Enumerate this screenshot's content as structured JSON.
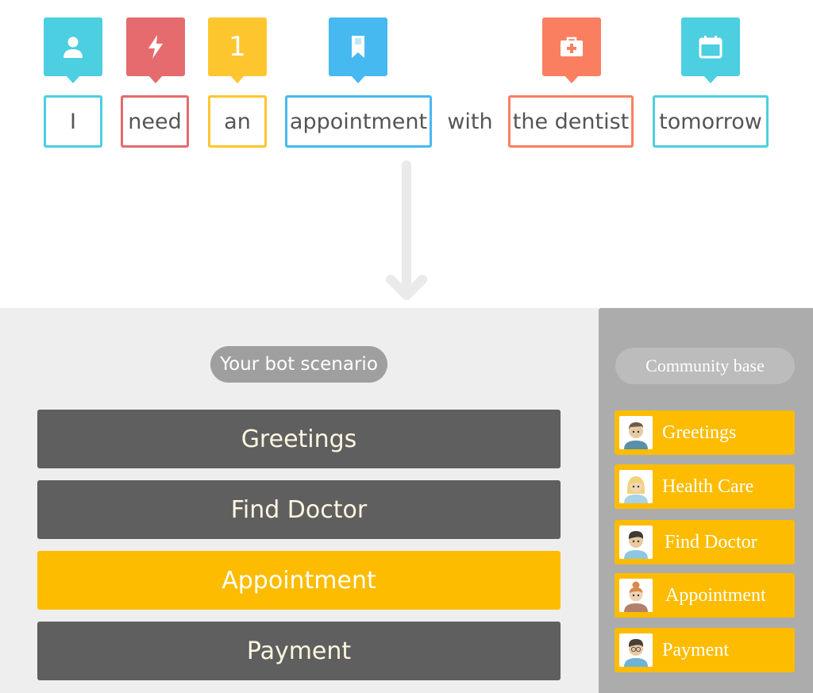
{
  "tokens": [
    {
      "word": "I",
      "icon": "person-icon",
      "color": "#4ccfe0"
    },
    {
      "word": "need",
      "icon": "lightning-icon",
      "color": "#e56b6f"
    },
    {
      "word": "an",
      "icon": "number-one-icon",
      "number": "1",
      "color": "#fec62e"
    },
    {
      "word": "appointment",
      "icon": "bookmark-icon",
      "color": "#46b9f1"
    },
    {
      "word": "the dentist",
      "icon": "medical-kit-icon",
      "color": "#fa7f61"
    },
    {
      "word": "tomorrow",
      "icon": "calendar-icon",
      "color": "#4ccfe0"
    }
  ],
  "connector_word": "with",
  "scenario": {
    "title": "Your bot scenario",
    "steps": [
      {
        "label": "Greetings",
        "highlighted": false
      },
      {
        "label": "Find Doctor",
        "highlighted": false
      },
      {
        "label": "Appointment",
        "highlighted": true
      },
      {
        "label": "Payment",
        "highlighted": false
      }
    ]
  },
  "community": {
    "title": "Community base",
    "items": [
      {
        "label": "Greetings",
        "avatar": "man-avatar-icon"
      },
      {
        "label": "Health Care",
        "avatar": "blonde-woman-avatar-icon"
      },
      {
        "label": "Find Doctor",
        "avatar": "young-man-avatar-icon"
      },
      {
        "label": "Appointment",
        "avatar": "woman-bun-avatar-icon"
      },
      {
        "label": "Payment",
        "avatar": "man-glasses-avatar-icon"
      }
    ]
  },
  "colors": {
    "accent": "#fdbc00",
    "step_dark": "#5f5f5f",
    "panel_light": "#eeeeee",
    "panel_gray": "#acacac"
  }
}
